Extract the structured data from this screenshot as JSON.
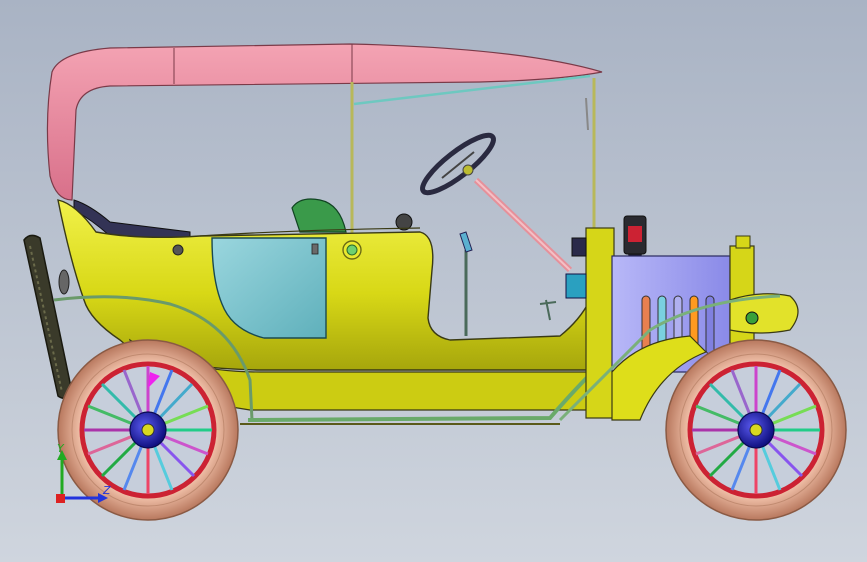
{
  "viewport": {
    "background_top": "#a9b3c4",
    "background_bottom": "#cdd3dc"
  },
  "model": {
    "name": "",
    "colors": {
      "roof": "#e8869a",
      "body": "#dede1a",
      "door": "#7cc5cf",
      "radiator": "#9b9bf2",
      "tire": "#d9a088",
      "rim": "#cc2233",
      "hub": "#1d1daa",
      "outline": "#3a3a14"
    }
  },
  "triad": {
    "y_label": "Y",
    "z_label": "Z",
    "colors": {
      "y": "#22aa22",
      "z": "#2233dd",
      "x": "#dd2222"
    }
  }
}
